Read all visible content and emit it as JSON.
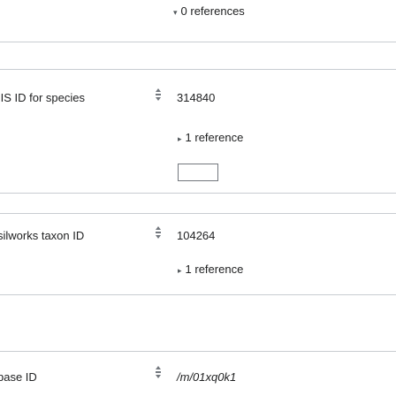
{
  "top": {
    "references_label": "0 references",
    "arrow": "▾"
  },
  "statements": [
    {
      "property": "IIS ID for species",
      "value": "314840",
      "references_label": "1 reference",
      "arrow": "▸"
    },
    {
      "property": "silworks taxon ID",
      "value": "104264",
      "references_label": "1 reference",
      "arrow": "▸"
    },
    {
      "property": "base ID",
      "value": "/m/01xq0k1"
    }
  ],
  "icons": {
    "rank": "normal-rank-icon"
  }
}
